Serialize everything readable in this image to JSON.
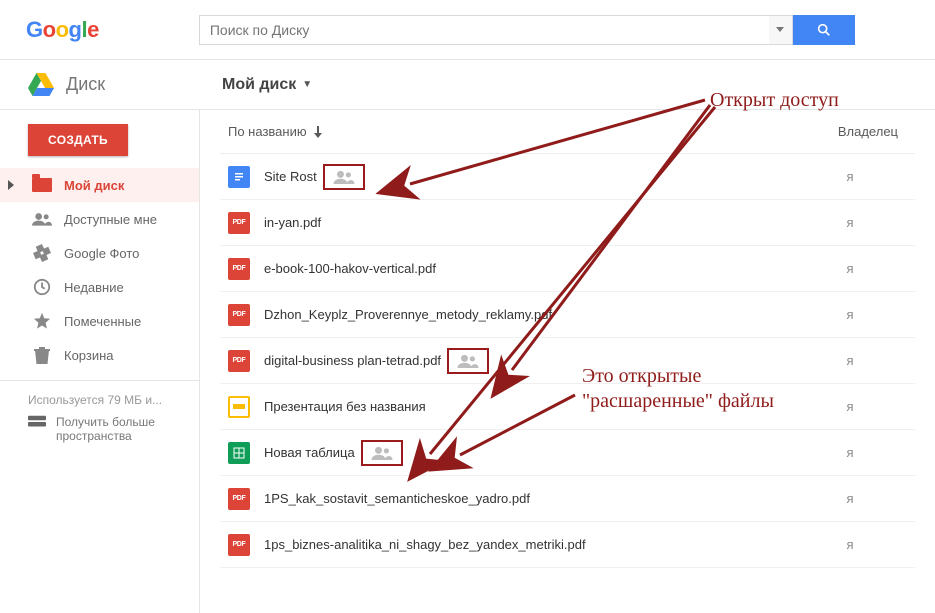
{
  "search": {
    "placeholder": "Поиск по Диску"
  },
  "brand": {
    "label": "Диск"
  },
  "breadcrumb": {
    "label": "Мой диск"
  },
  "create_button": "СОЗДАТЬ",
  "sidebar": {
    "items": [
      {
        "label": "Мой диск",
        "icon": "folder"
      },
      {
        "label": "Доступные мне",
        "icon": "people"
      },
      {
        "label": "Google Фото",
        "icon": "photos"
      },
      {
        "label": "Недавние",
        "icon": "clock"
      },
      {
        "label": "Помеченные",
        "icon": "star"
      },
      {
        "label": "Корзина",
        "icon": "trash"
      }
    ],
    "storage_text": "Используется 79 МБ и...",
    "more_storage": "Получить больше пространства"
  },
  "columns": {
    "name": "По названию",
    "owner": "Владелец"
  },
  "owner_value": "я",
  "files": [
    {
      "name": "Site Rost",
      "type": "doc",
      "shared": true
    },
    {
      "name": "in-yan.pdf",
      "type": "pdf",
      "shared": false
    },
    {
      "name": "e-book-100-hakov-vertical.pdf",
      "type": "pdf",
      "shared": false
    },
    {
      "name": "Dzhon_Keyplz_Proverennye_metody_reklamy.pdf",
      "type": "pdf",
      "shared": false
    },
    {
      "name": "digital-business plan-tetrad.pdf",
      "type": "pdf",
      "shared": true
    },
    {
      "name": "Презентация без названия",
      "type": "slides",
      "shared": false
    },
    {
      "name": "Новая таблица",
      "type": "sheet",
      "shared": true
    },
    {
      "name": "1PS_kak_sostavit_semanticheskoe_yadro.pdf",
      "type": "pdf",
      "shared": false
    },
    {
      "name": "1ps_biznes-analitika_ni_shagy_bez_yandex_metriki.pdf",
      "type": "pdf",
      "shared": false
    }
  ],
  "annotations": {
    "top": "Открыт доступ",
    "middle": "Это открытые \"расшаренные\" файлы"
  }
}
